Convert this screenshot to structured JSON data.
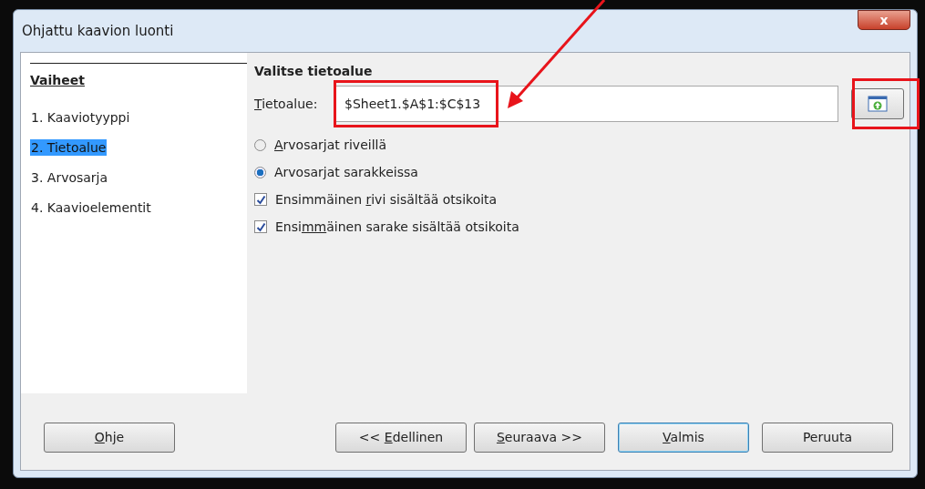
{
  "window": {
    "title": "Ohjattu kaavion luonti",
    "close_label": "x"
  },
  "steps": {
    "heading": "Vaiheet",
    "items": [
      {
        "label": "1. Kaaviotyyppi",
        "selected": false
      },
      {
        "label": "2. Tietoalue",
        "selected": true
      },
      {
        "label": "3. Arvosarja",
        "selected": false
      },
      {
        "label": "4. Kaavioelementit",
        "selected": false
      }
    ]
  },
  "section_title": "Valitse tietoalue",
  "range_field": {
    "label_key": "T",
    "label_rest": "ietoalue:",
    "value": "$Sheet1.$A$1:$C$13"
  },
  "options": [
    {
      "kind": "radio",
      "key": "A",
      "after": "rvosarjat riveillä",
      "checked": false
    },
    {
      "kind": "radio",
      "before": "Arvosar",
      "key": "j",
      "after": "at sarakkeissa",
      "checked": true
    },
    {
      "kind": "checkbox",
      "before": "Ensimmäinen ",
      "key": "r",
      "after": "ivi sisältää otsikoita",
      "checked": true
    },
    {
      "kind": "checkbox",
      "before": "Ensi",
      "key": "mm",
      "after": "äinen sarake sisältää otsikoita",
      "checked": true
    }
  ],
  "buttons": [
    {
      "key": "O",
      "after": "hje",
      "default": false
    },
    {
      "before": "<< ",
      "key": "E",
      "after": "dellinen",
      "default": false
    },
    {
      "key": "S",
      "after": "euraava >>",
      "default": false
    },
    {
      "key": "V",
      "after": "almis",
      "default": true
    },
    {
      "before": "Peruuta",
      "default": false
    }
  ]
}
